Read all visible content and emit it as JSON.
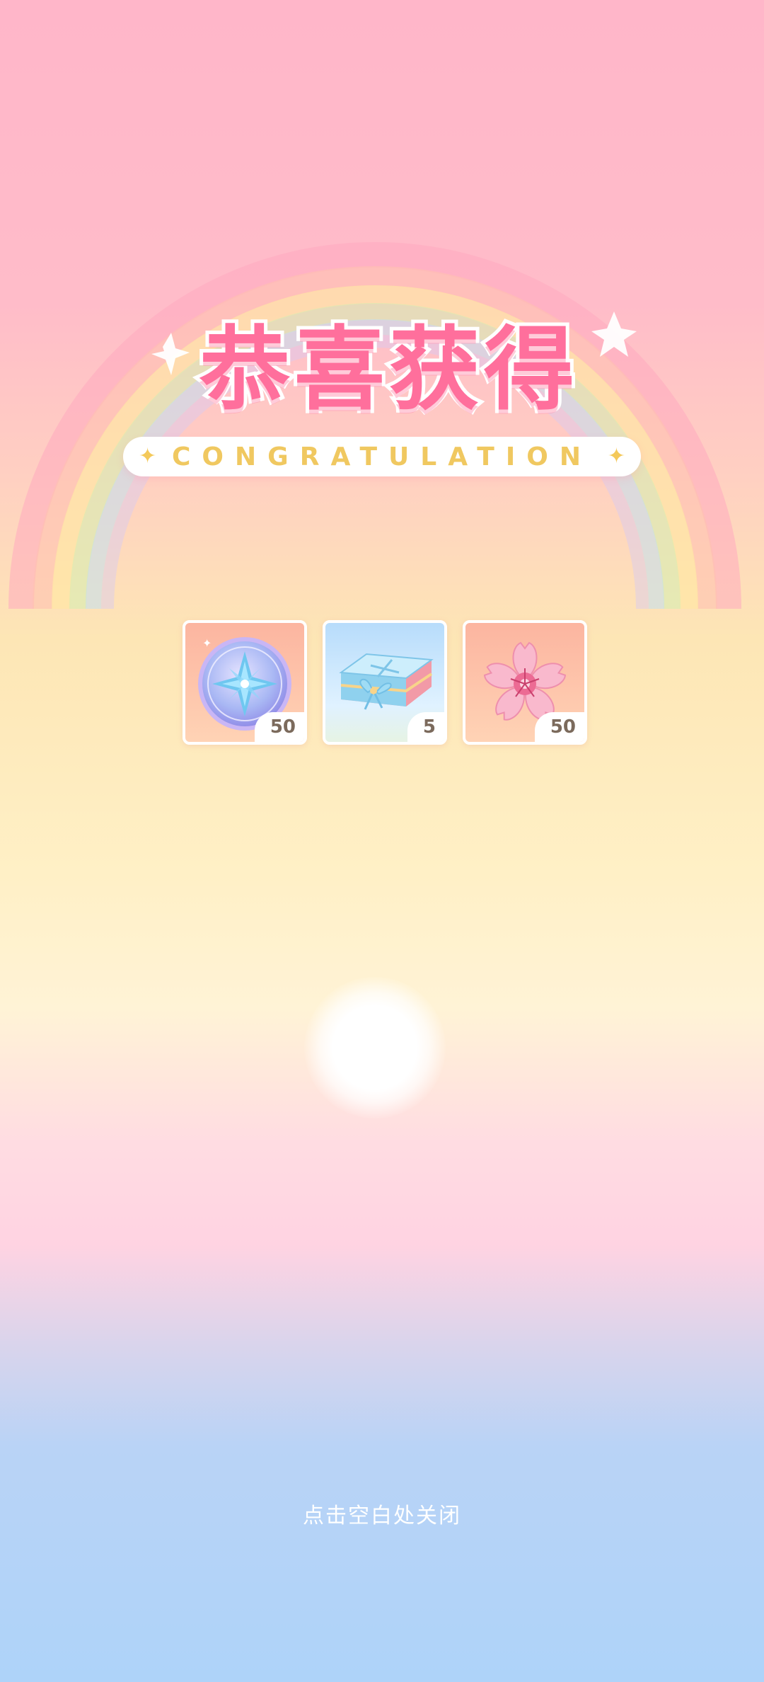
{
  "title": {
    "main": "恭喜获得",
    "subtitle": "CONGRATULATION"
  },
  "rewards": [
    {
      "name": "star-coin",
      "icon": "compass-star-coin-icon",
      "quantity": "50"
    },
    {
      "name": "gift-box",
      "icon": "gift-box-icon",
      "quantity": "5"
    },
    {
      "name": "sakura-flower",
      "icon": "sakura-flower-icon",
      "quantity": "50"
    }
  ],
  "close_hint": "点击空白处关闭",
  "colors": {
    "title_pink": "#ff6f9c",
    "subtitle_gold": "#f0c860",
    "quantity_text": "#7b6a5c"
  }
}
